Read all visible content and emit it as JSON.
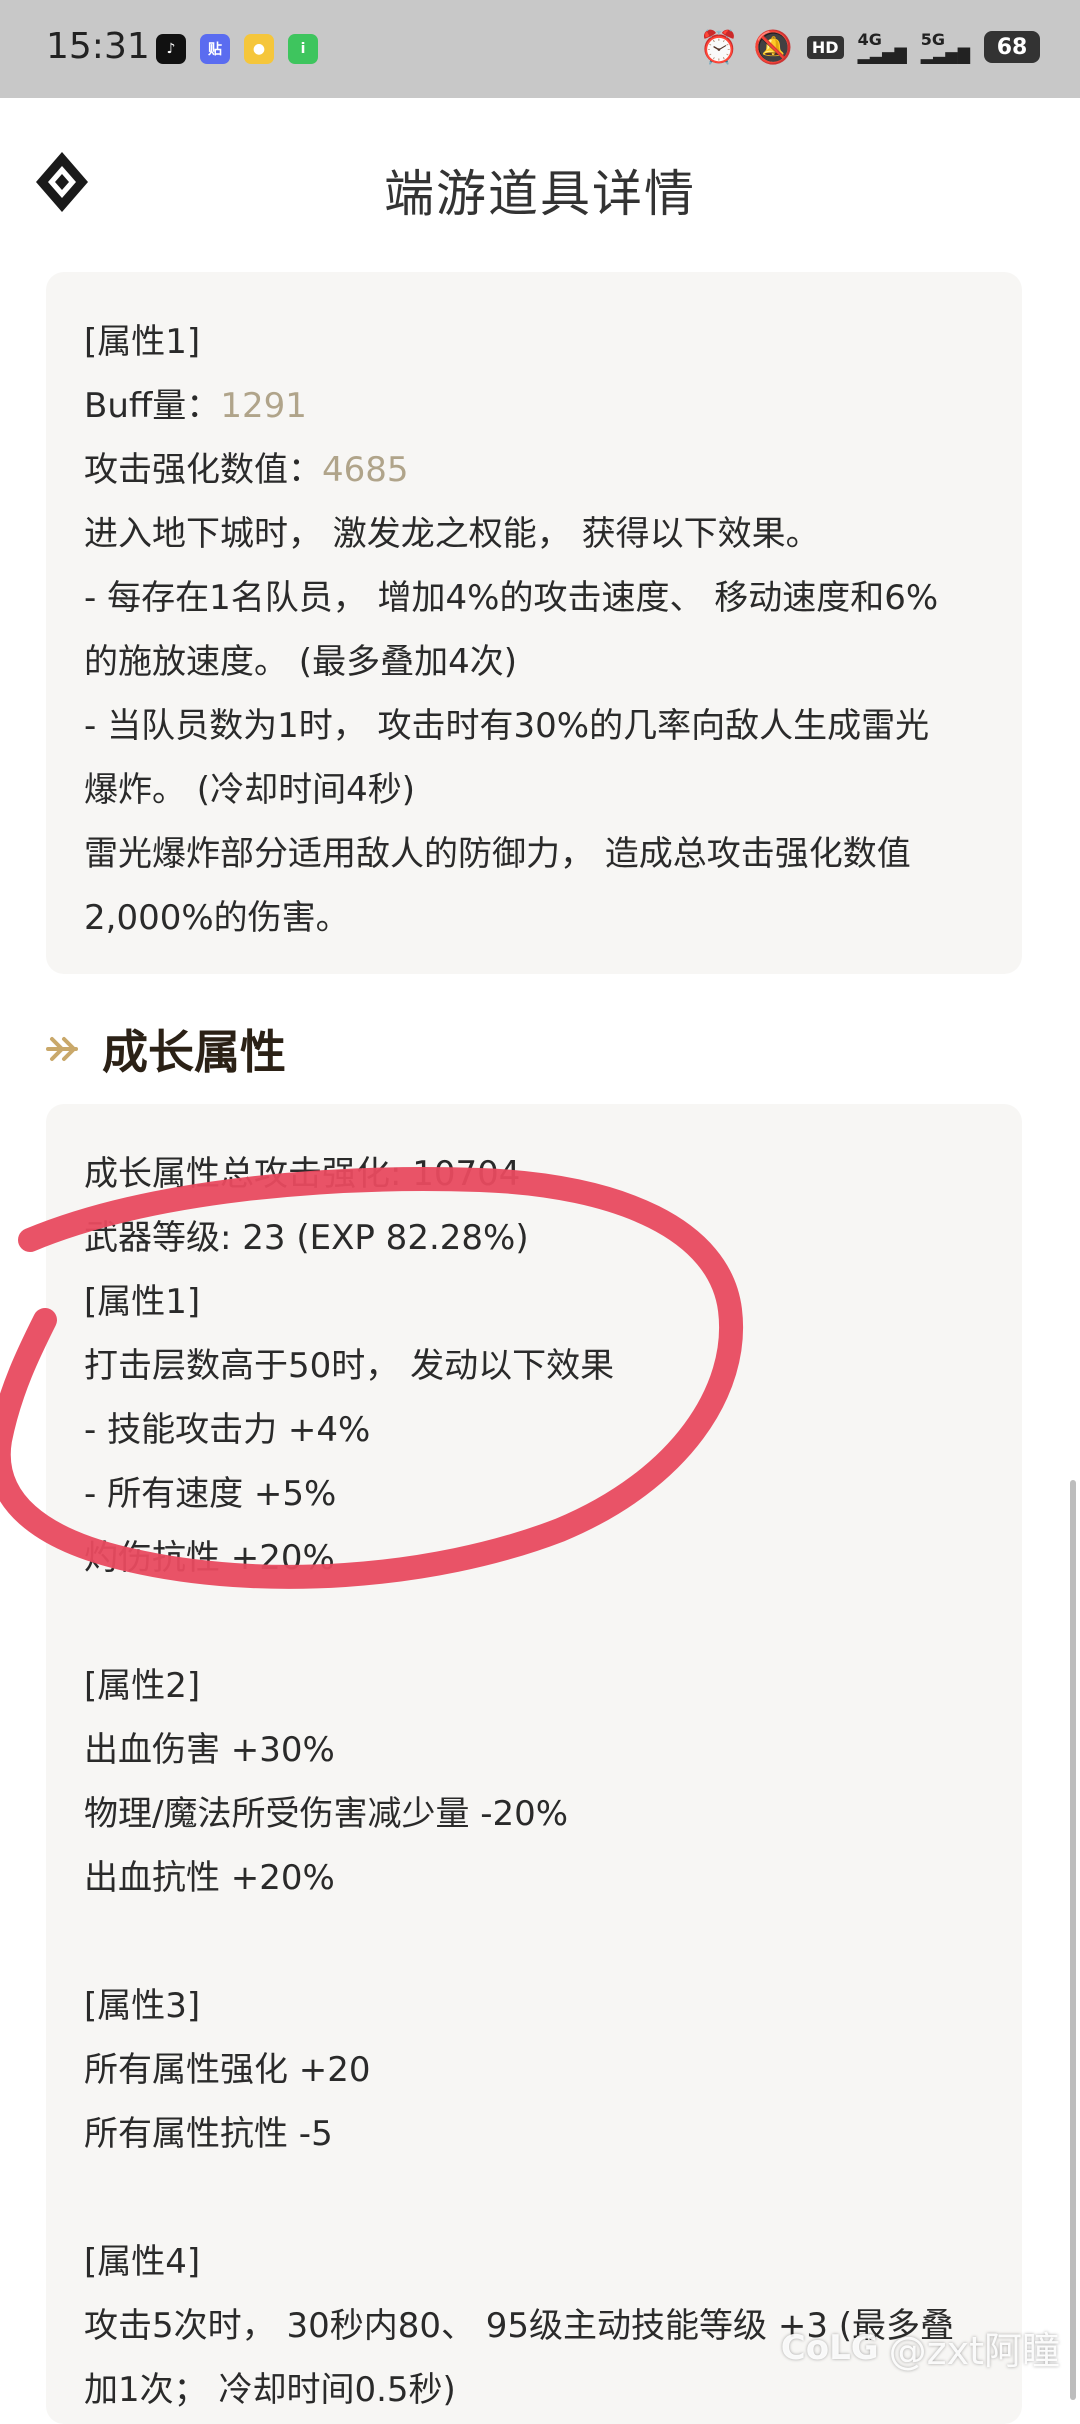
{
  "status_bar": {
    "time": "15:31",
    "app_icons": [
      "tiktok-icon",
      "tieba-icon",
      "maps-icon",
      "iqiyi-icon"
    ],
    "icons": [
      "alarm-icon",
      "mute-icon",
      "hd-icon",
      "signal-4g-icon",
      "signal-5g-icon"
    ],
    "network_4g": "4G",
    "network_5g": "5G",
    "battery": "68"
  },
  "header": {
    "title": "端游道具详情"
  },
  "card1": {
    "attr_label": "[属性1]",
    "buff_label": "Buff量：",
    "buff_value": "1291",
    "atk_label": "攻击强化数值：",
    "atk_value": "4685",
    "lines": [
      "进入地下城时， 激发龙之权能， 获得以下效果。",
      "- 每存在1名队员， 增加4%的攻击速度、 移动速度和6%",
      "的施放速度。 (最多叠加4次)",
      "- 当队员数为1时， 攻击时有30%的几率向敌人生成雷光",
      "爆炸。 (冷却时间4秒)",
      "雷光爆炸部分适用敌人的防御力， 造成总攻击强化数值",
      "2,000%的伤害。"
    ]
  },
  "growth": {
    "section_title": "成长属性",
    "total_line": "成长属性总攻击强化: 10704",
    "level_line": "武器等级: 23 (EXP 82.28%)",
    "attr1": {
      "label": "[属性1]",
      "lines": [
        "打击层数高于50时， 发动以下效果",
        "- 技能攻击力 +4%",
        "- 所有速度 +5%",
        "灼伤抗性 +20%"
      ]
    },
    "attr2": {
      "label": "[属性2]",
      "lines": [
        "出血伤害 +30%",
        "物理/魔法所受伤害减少量 -20%",
        "出血抗性 +20%"
      ]
    },
    "attr3": {
      "label": "[属性3]",
      "lines": [
        "所有属性强化 +20",
        "所有属性抗性 -5"
      ]
    },
    "attr4": {
      "label": "[属性4]",
      "lines": [
        "攻击5次时， 30秒内80、 95级主动技能等级 +3 (最多叠",
        "加1次； 冷却时间0.5秒)"
      ]
    }
  },
  "watermark": {
    "logo": "CoLG",
    "text": "@zxt阿瞳"
  },
  "colors": {
    "status_bar": "#c8c8c8",
    "card_bg": "#f7f6f4",
    "value_text": "#b0a48a",
    "accent_arrow": "#c9a86a",
    "annotation": "#e84a5f"
  }
}
